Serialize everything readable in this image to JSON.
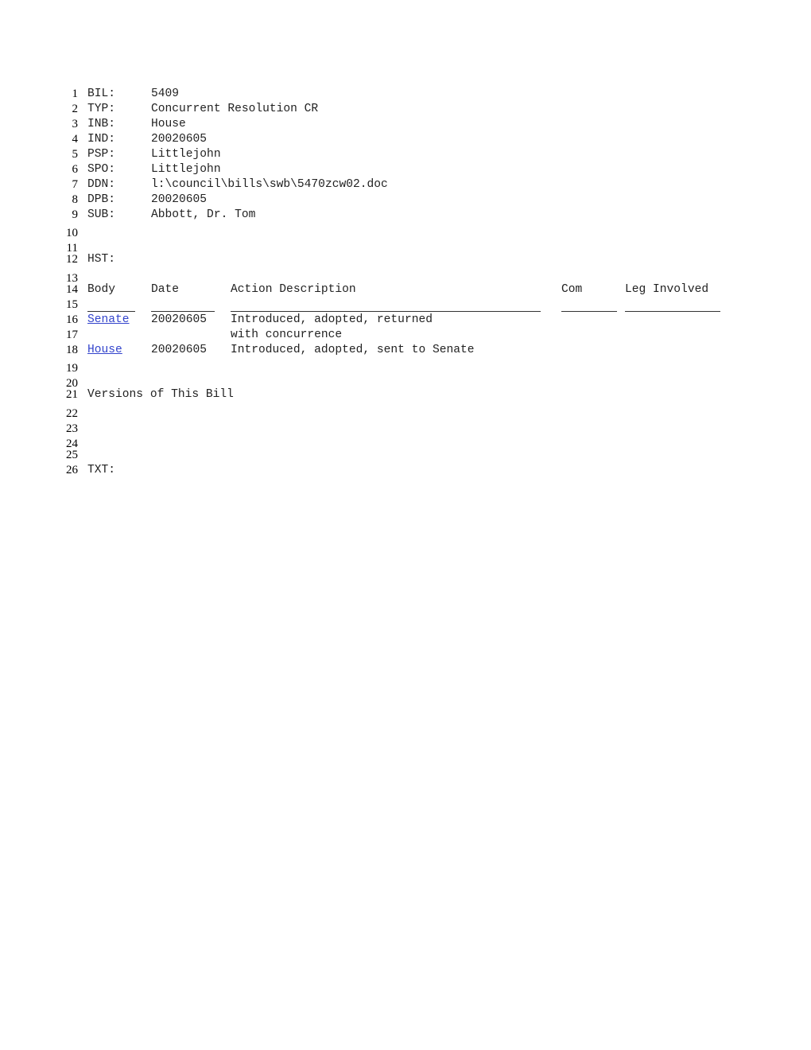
{
  "fields": [
    {
      "label": "BIL:",
      "value": "5409"
    },
    {
      "label": "TYP:",
      "value": "Concurrent Resolution CR"
    },
    {
      "label": "INB:",
      "value": "House"
    },
    {
      "label": "IND:",
      "value": "20020605"
    },
    {
      "label": "PSP:",
      "value": "Littlejohn"
    },
    {
      "label": "SPO:",
      "value": "Littlejohn"
    },
    {
      "label": "DDN:",
      "value": "l:\\council\\bills\\swb\\5470zcw02.doc"
    },
    {
      "label": "DPB:",
      "value": "20020605"
    },
    {
      "label": "SUB:",
      "value": "Abbott, Dr. Tom"
    }
  ],
  "line_numbers": [
    "1",
    "2",
    "3",
    "4",
    "5",
    "6",
    "7",
    "8",
    "9",
    "10",
    "11",
    "12",
    "13",
    "14",
    "15",
    "16",
    "17",
    "18",
    "19",
    "20",
    "21",
    "22",
    "23",
    "24",
    "25",
    "26"
  ],
  "history": {
    "label": "HST:",
    "headers": {
      "body": "Body",
      "date": "Date",
      "action": "Action Description",
      "com": "Com",
      "leg": "Leg Involved"
    },
    "rows": [
      {
        "body": "Senate",
        "date": "20020605",
        "action": "Introduced, adopted, returned",
        "action_cont": "with concurrence"
      },
      {
        "body": "House",
        "date": "20020605",
        "action": "Introduced, adopted, sent to Senate"
      }
    ]
  },
  "versions_heading": "Versions of This Bill",
  "txt_label": "TXT:"
}
